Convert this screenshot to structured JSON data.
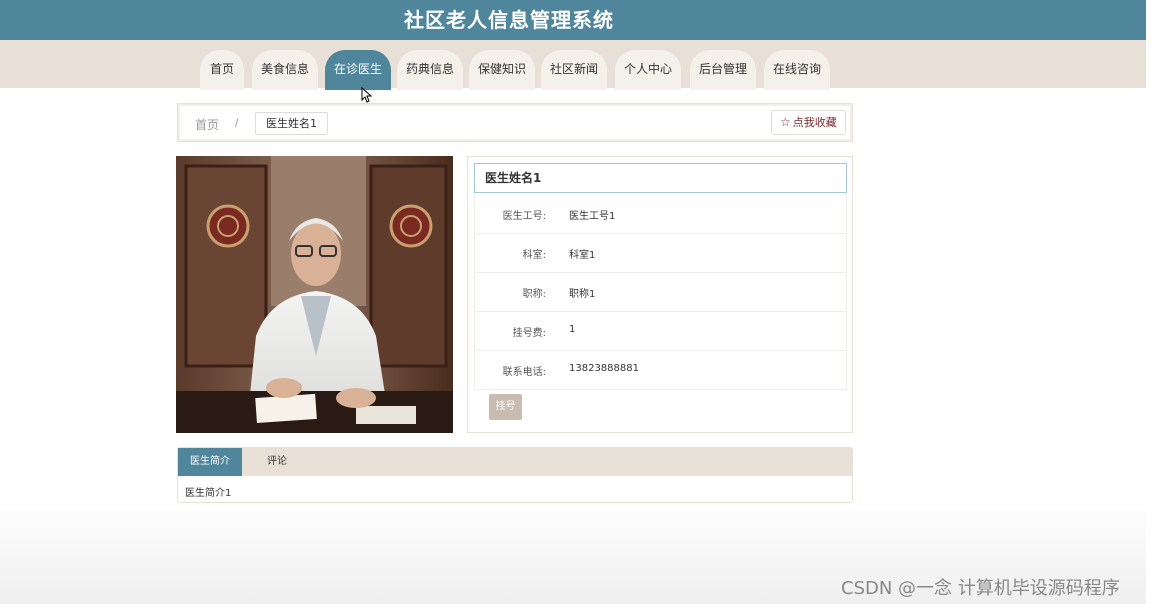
{
  "app": {
    "title": "社区老人信息管理系统"
  },
  "nav": {
    "tabs": [
      {
        "label": "首页"
      },
      {
        "label": "美食信息"
      },
      {
        "label": "在诊医生",
        "active": true
      },
      {
        "label": "药典信息"
      },
      {
        "label": "保健知识"
      },
      {
        "label": "社区新闻"
      },
      {
        "label": "个人中心"
      },
      {
        "label": "后台管理"
      },
      {
        "label": "在线咨询"
      }
    ]
  },
  "breadcrumb": {
    "home": "首页",
    "separator": "/",
    "current": "医生姓名1"
  },
  "favorite": {
    "label": "点我收藏",
    "icon": "star-outline-icon"
  },
  "doctor": {
    "name": "医生姓名1",
    "fields": [
      {
        "label": "医生工号:",
        "value": "医生工号1"
      },
      {
        "label": "科室:",
        "value": "科室1"
      },
      {
        "label": "职称:",
        "value": "职称1"
      },
      {
        "label": "挂号费:",
        "value": "1"
      },
      {
        "label": "联系电话:",
        "value": "13823888881"
      }
    ],
    "register_label": "挂号"
  },
  "detail_tabs": {
    "tabs": [
      {
        "label": "医生简介",
        "active": true
      },
      {
        "label": "评论"
      }
    ],
    "content": "医生简介1"
  },
  "watermark": "CSDN @一念 计算机毕设源码程序",
  "colors": {
    "header": "#4f869b",
    "nav_bg": "#e8e0d6",
    "tab_bg": "#f4f0ea",
    "accent": "#4f869b",
    "button_disabled": "#c8bcb0"
  }
}
